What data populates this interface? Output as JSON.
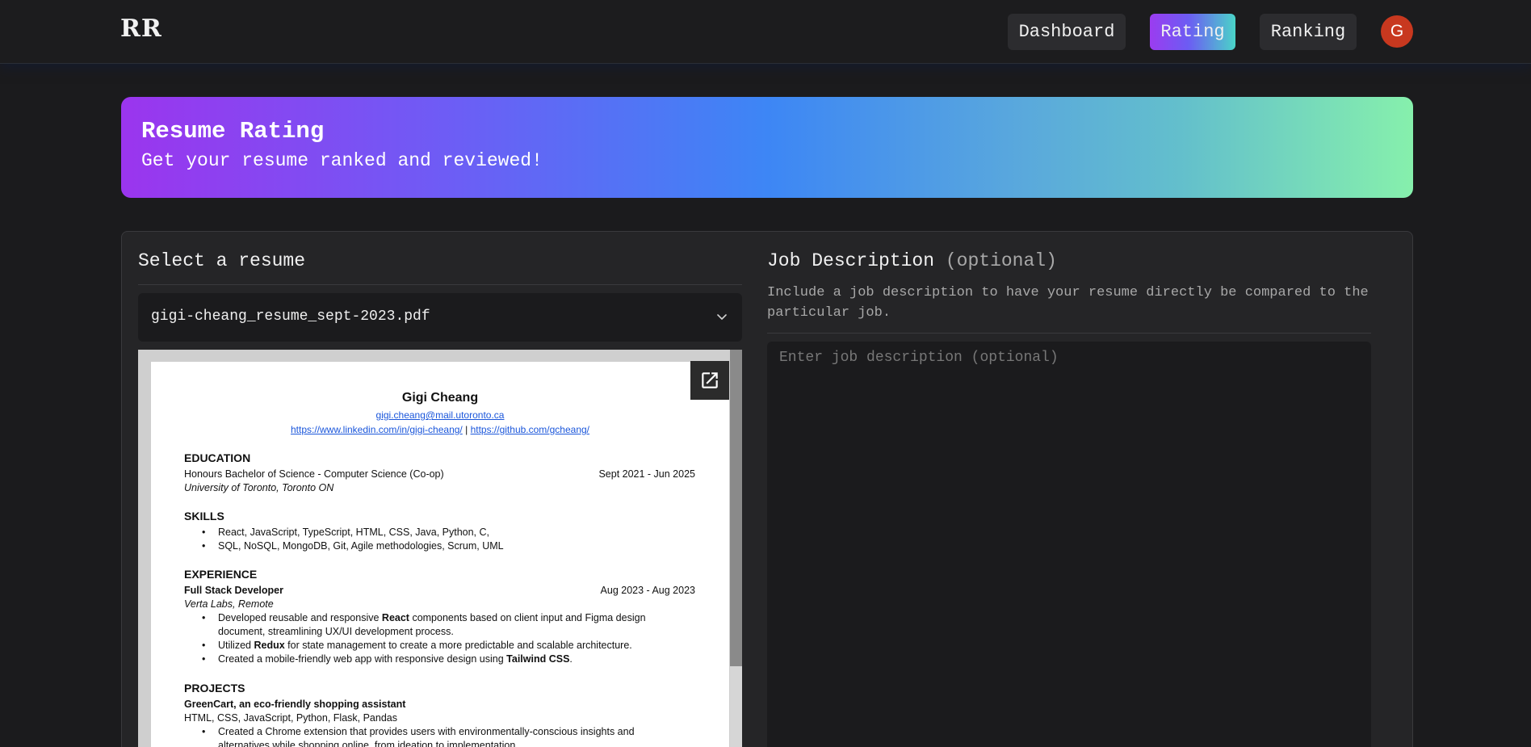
{
  "header": {
    "logo": "RR",
    "nav": {
      "dashboard": "Dashboard",
      "rating": "Rating",
      "ranking": "Ranking"
    },
    "avatar_initial": "G",
    "active_tab": "Rating"
  },
  "banner": {
    "title": "Resume Rating",
    "subtitle": "Get your resume ranked and reviewed!"
  },
  "resume_panel": {
    "title": "Select a resume",
    "selected_file": "gigi-cheang_resume_sept-2023.pdf",
    "preview": {
      "name": "Gigi Cheang",
      "email": "gigi.cheang@mail.utoronto.ca",
      "linkedin": "https://www.linkedin.com/in/gigi-cheang/",
      "separator": "|",
      "github": "https://github.com/gcheang/",
      "education_heading": "EDUCATION",
      "degree": "Honours Bachelor of Science - Computer Science (Co-op)",
      "degree_dates": "Sept 2021 - Jun 2025",
      "school": "University of Toronto, Toronto ON",
      "skills_heading": "SKILLS",
      "skills": [
        "React, JavaScript, TypeScript,  HTML, CSS, Java, Python, C,",
        "SQL, NoSQL, MongoDB, Git, Agile methodologies, Scrum, UML"
      ],
      "experience_heading": "EXPERIENCE",
      "job_title": "Full Stack Developer",
      "job_dates": "Aug 2023 - Aug 2023",
      "company": "Verta Labs, Remote",
      "job_bullets": {
        "b1_pre": "Developed reusable and responsive ",
        "b1_bold": "React",
        "b1_post": " components based on client input and Figma design",
        "b1_cont": "document, streamlining UX/UI development process.",
        "b2_pre": "Utilized ",
        "b2_bold": "Redux",
        "b2_post": " for state management to create a more predictable and scalable architecture.",
        "b3_pre": "Created a mobile-friendly web app with responsive design using ",
        "b3_bold": "Tailwind CSS",
        "b3_post": "."
      },
      "projects_heading": "PROJECTS",
      "project_title": "GreenCart, an eco-friendly shopping assistant",
      "project_stack": "HTML, CSS, JavaScript, Python, Flask, Pandas",
      "project_bullets": [
        "Created a Chrome extension that provides users with environmentally-conscious insights and",
        "alternatives while shopping online, from ideation to implementation."
      ]
    }
  },
  "job_panel": {
    "title": "Job Description",
    "title_suffix": "(optional)",
    "description": "Include a job description to have your resume directly be compared to the particular job.",
    "placeholder": "Enter job description (optional)"
  },
  "icons": {
    "dropdown": "chevron-down-icon",
    "open": "open-external-icon"
  }
}
